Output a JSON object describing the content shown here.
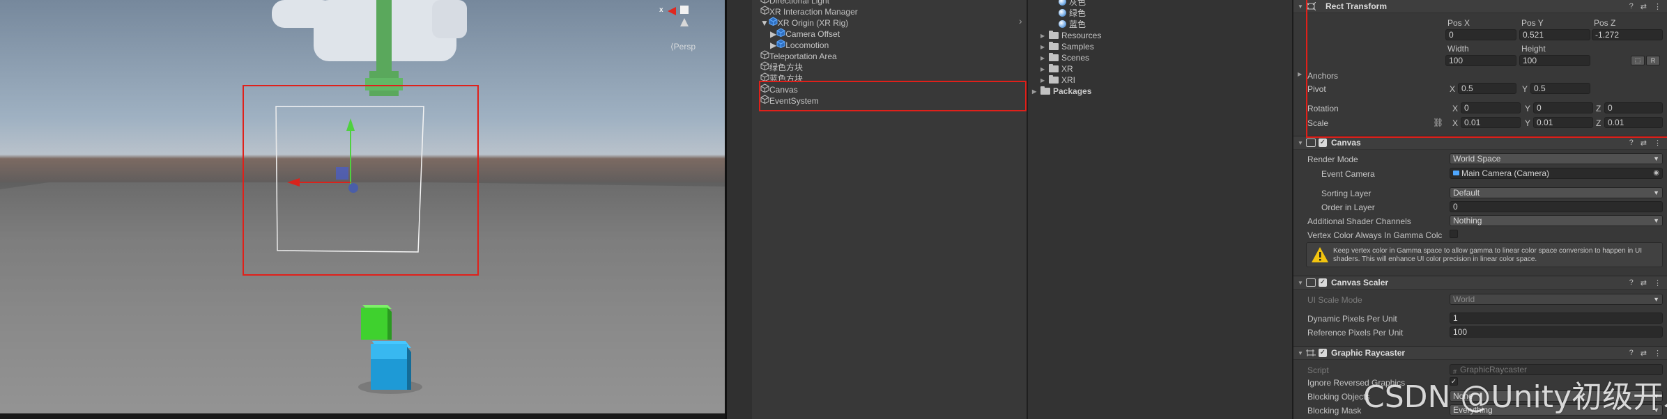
{
  "scene": {
    "persp_label": "⟨Persp",
    "gizmo_axis_x": "x"
  },
  "hierarchy": {
    "items": [
      {
        "label": "Directional Light",
        "blue": false,
        "arrow": ""
      },
      {
        "label": "XR Interaction Manager",
        "blue": false,
        "arrow": ""
      },
      {
        "label": "XR Origin (XR Rig)",
        "blue": true,
        "arrow": "▼"
      },
      {
        "label": "Camera Offset",
        "blue": true,
        "arrow": "▶"
      },
      {
        "label": "Locomotion",
        "blue": true,
        "arrow": "▶"
      },
      {
        "label": "Teleportation Area",
        "blue": false,
        "arrow": ""
      },
      {
        "label": "绿色方块",
        "blue": false,
        "arrow": ""
      },
      {
        "label": "蓝色方块",
        "blue": false,
        "arrow": ""
      },
      {
        "label": "Canvas",
        "blue": false,
        "arrow": "",
        "selected": true
      },
      {
        "label": "EventSystem",
        "blue": false,
        "arrow": ""
      }
    ]
  },
  "project": {
    "materials": [
      "灰色",
      "绿色",
      "蓝色"
    ],
    "folders": [
      "Resources",
      "Samples",
      "Scenes",
      "XR",
      "XRI"
    ],
    "packages_label": "Packages"
  },
  "inspector": {
    "rect_transform": {
      "title": "Rect Transform",
      "pos_x_label": "Pos X",
      "pos_y_label": "Pos Y",
      "pos_z_label": "Pos Z",
      "pos_x": "0",
      "pos_y": "0.521",
      "pos_z": "-1.272",
      "width_label": "Width",
      "height_label": "Height",
      "width": "100",
      "height": "100",
      "r_button": "R",
      "anchors_label": "Anchors",
      "pivot_label": "Pivot",
      "pivot_x": "0.5",
      "pivot_y": "0.5",
      "rotation_label": "Rotation",
      "rot_x": "0",
      "rot_y": "0",
      "rot_z": "0",
      "scale_label": "Scale",
      "scale_x": "0.01",
      "scale_y": "0.01",
      "scale_z": "0.01",
      "axis_x": "X",
      "axis_y": "Y",
      "axis_z": "Z"
    },
    "canvas": {
      "title": "Canvas",
      "render_mode_label": "Render Mode",
      "render_mode": "World Space",
      "event_camera_label": "Event Camera",
      "event_camera": "Main Camera (Camera)",
      "sorting_layer_label": "Sorting Layer",
      "sorting_layer": "Default",
      "order_in_layer_label": "Order in Layer",
      "order_in_layer": "0",
      "shader_channels_label": "Additional Shader Channels",
      "shader_channels": "Nothing",
      "vertex_color_label": "Vertex Color Always In Gamma Colc",
      "warning": "Keep vertex color in Gamma space to allow gamma to linear color space conversion to happen in UI shaders. This will enhance UI color precision in linear color space."
    },
    "canvas_scaler": {
      "title": "Canvas Scaler",
      "ui_scale_mode_label": "UI Scale Mode",
      "ui_scale_mode": "World",
      "dynamic_pixels_label": "Dynamic Pixels Per Unit",
      "dynamic_pixels": "1",
      "reference_pixels_label": "Reference Pixels Per Unit",
      "reference_pixels": "100"
    },
    "graphic_raycaster": {
      "title": "Graphic Raycaster",
      "script_label": "Script",
      "script": "GraphicRaycaster",
      "ignore_reversed_label": "Ignore Reversed Graphics",
      "blocking_objects_label": "Blocking Objects",
      "blocking_objects": "None",
      "blocking_mask_label": "Blocking Mask",
      "blocking_mask": "Everything"
    }
  },
  "watermark": "CSDN @Unity初级开发者",
  "colors": {
    "highlight_red": "#e0201a",
    "hierarchy_blue": "#7fb6ff",
    "gizmo_green": "#4fd13f",
    "gizmo_red": "#d9231c",
    "cube_green": "#3fd12e",
    "cube_blue": "#1e9ad6"
  }
}
